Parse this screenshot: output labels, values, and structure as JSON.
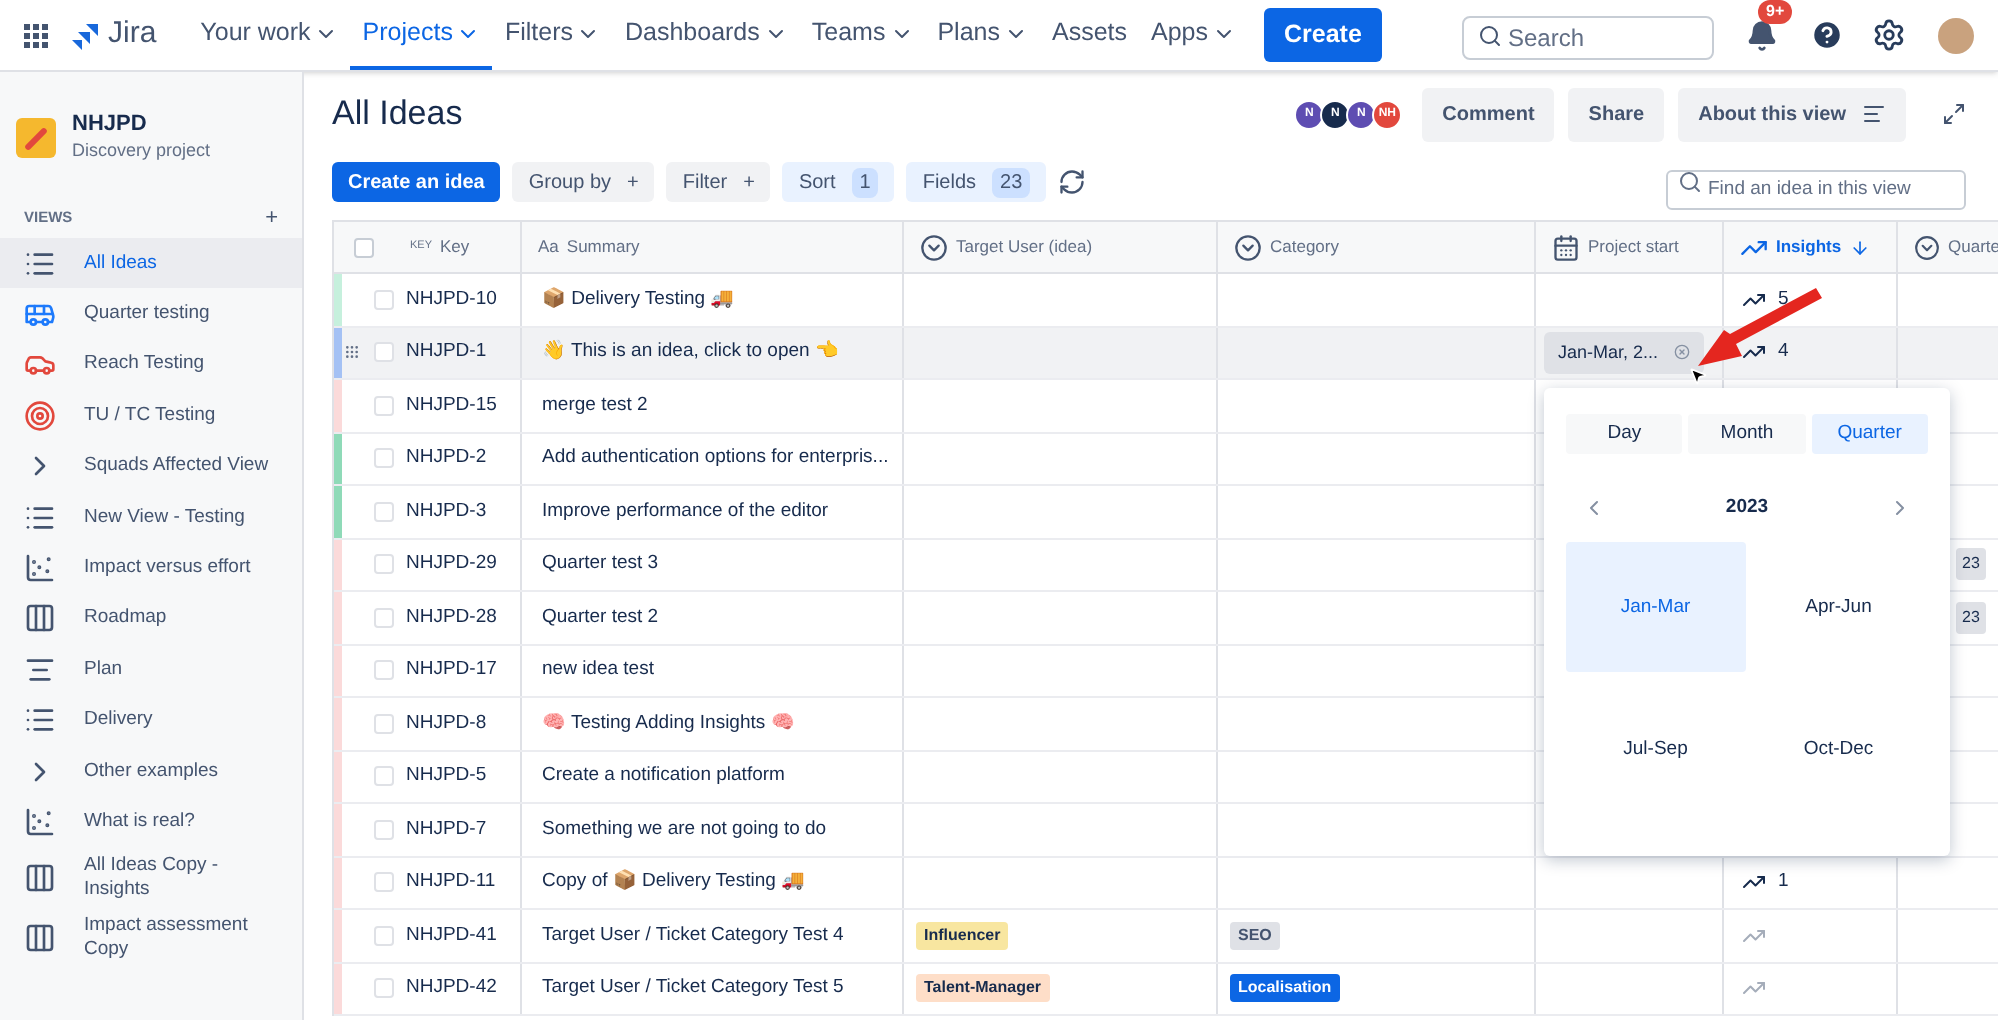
{
  "nav": {
    "items": [
      {
        "label": "Your work",
        "dropdown": true,
        "selected": false
      },
      {
        "label": "Projects",
        "dropdown": true,
        "selected": true
      },
      {
        "label": "Filters",
        "dropdown": true,
        "selected": false
      },
      {
        "label": "Dashboards",
        "dropdown": true,
        "selected": false
      },
      {
        "label": "Teams",
        "dropdown": true,
        "selected": false
      },
      {
        "label": "Plans",
        "dropdown": true,
        "selected": false
      },
      {
        "label": "Assets",
        "dropdown": false,
        "selected": false
      },
      {
        "label": "Apps",
        "dropdown": true,
        "selected": false
      }
    ],
    "logo": "Jira",
    "create": "Create",
    "search": {
      "placeholder": "Search"
    },
    "notifications": "9+"
  },
  "project": {
    "name": "NHJPD",
    "type": "Discovery project"
  },
  "sidebar": {
    "heading": "VIEWS",
    "add": "+",
    "items": [
      {
        "label": "All Ideas",
        "kind": "list",
        "selected": true
      },
      {
        "label": "Quarter testing",
        "kind": "bus",
        "selected": false
      },
      {
        "label": "Reach Testing",
        "kind": "car",
        "selected": false
      },
      {
        "label": "TU / TC Testing",
        "kind": "target",
        "selected": false
      },
      {
        "label": "Squads Affected View",
        "kind": "section",
        "selected": false
      },
      {
        "label": "New View - Testing",
        "kind": "list",
        "selected": false
      },
      {
        "label": "Impact versus effort",
        "kind": "matrix",
        "selected": false
      },
      {
        "label": "Roadmap",
        "kind": "board",
        "selected": false
      },
      {
        "label": "Plan",
        "kind": "timeline",
        "selected": false
      },
      {
        "label": "Delivery",
        "kind": "list",
        "selected": false
      },
      {
        "label": "Other examples",
        "kind": "section",
        "selected": false
      },
      {
        "label": "What is real?",
        "kind": "matrix",
        "selected": false
      },
      {
        "label": "All Ideas Copy - Insights",
        "kind": "board",
        "selected": false
      },
      {
        "label": "Impact assessment Copy",
        "kind": "board",
        "selected": false
      }
    ]
  },
  "header": {
    "title": "All Ideas",
    "avatars": [
      {
        "initials": "N",
        "color": "#5e4db2"
      },
      {
        "initials": "N",
        "color": "#172b4d"
      },
      {
        "initials": "N",
        "color": "#5e4db2"
      },
      {
        "initials": "NH",
        "color": "#e2483d"
      }
    ],
    "comment": "Comment",
    "share": "Share",
    "about": "About this view"
  },
  "toolbar": {
    "buttons": [
      {
        "label": "Create an idea",
        "kind": "primary"
      },
      {
        "label": "Group by",
        "kind": "add",
        "badge": "+"
      },
      {
        "label": "Filter",
        "kind": "add",
        "badge": "+"
      },
      {
        "label": "Sort",
        "kind": "count",
        "badge": "1"
      },
      {
        "label": "Fields",
        "kind": "count",
        "badge": "23"
      }
    ],
    "find": {
      "placeholder": "Find an idea in this view"
    }
  },
  "table": {
    "select_all": {
      "checked": false
    },
    "columns": [
      {
        "kind": "key",
        "prefix": "KEY",
        "label": "Key",
        "sorted": false
      },
      {
        "kind": "summary",
        "prefix": "Aa",
        "label": "Summary",
        "sorted": false
      },
      {
        "kind": "select",
        "label": "Target User (idea)",
        "sorted": false
      },
      {
        "kind": "select",
        "label": "Category",
        "sorted": false
      },
      {
        "kind": "date",
        "label": "Project start",
        "sorted": false
      },
      {
        "kind": "insights",
        "label": "Insights",
        "sorted": true
      },
      {
        "kind": "select",
        "label": "Quarte",
        "sorted": false
      }
    ],
    "rows": [
      {
        "key": "NHJPD-10",
        "summary": "📦 Delivery Testing 🚚",
        "color": "#c6f0dd",
        "checked": false,
        "hovered": false,
        "insights": {
          "count": "5",
          "faded": false
        }
      },
      {
        "key": "NHJPD-1",
        "summary": "👋 This is an idea, click to open 👈",
        "color": "#a4c1f4",
        "checked": false,
        "hovered": true,
        "project_start": "Jan-Mar, 2...",
        "insights": {
          "count": "4",
          "faded": false
        }
      },
      {
        "key": "NHJPD-15",
        "summary": "merge test 2",
        "color": "#fbdada",
        "checked": false,
        "hovered": false
      },
      {
        "key": "NHJPD-2",
        "summary": "Add authentication options for enterpris...",
        "color": "#8fdab8",
        "checked": false,
        "hovered": false
      },
      {
        "key": "NHJPD-3",
        "summary": "Improve performance of the editor",
        "color": "#8fdab8",
        "checked": false,
        "hovered": false
      },
      {
        "key": "NHJPD-29",
        "summary": "Quarter test 3",
        "color": "#fbdada",
        "checked": false,
        "hovered": false,
        "quarter": "23"
      },
      {
        "key": "NHJPD-28",
        "summary": "Quarter test 2",
        "color": "#fbdada",
        "checked": false,
        "hovered": false,
        "quarter": "23"
      },
      {
        "key": "NHJPD-17",
        "summary": "new idea test",
        "color": "#fbdada",
        "checked": false,
        "hovered": false
      },
      {
        "key": "NHJPD-8",
        "summary": "🧠 Testing Adding Insights 🧠",
        "color": "#fbdada",
        "checked": false,
        "hovered": false
      },
      {
        "key": "NHJPD-5",
        "summary": "Create a notification platform",
        "color": "#fbdada",
        "checked": false,
        "hovered": false
      },
      {
        "key": "NHJPD-7",
        "summary": "Something we are not going to do",
        "color": "#fbdada",
        "checked": false,
        "hovered": false
      },
      {
        "key": "NHJPD-11",
        "summary": "Copy of 📦 Delivery Testing 🚚",
        "color": "#fbdada",
        "checked": false,
        "hovered": false,
        "insights": {
          "count": "1",
          "faded": false
        }
      },
      {
        "key": "NHJPD-41",
        "summary": "Target User / Ticket Category Test 4",
        "color": "#fbdada",
        "checked": false,
        "hovered": false,
        "target_user": {
          "label": "Influencer",
          "color": "#f8e6a0"
        },
        "category": {
          "label": "SEO",
          "color": "#dfe1e6"
        },
        "insights": {
          "faded": true
        }
      },
      {
        "key": "NHJPD-42",
        "summary": "Target User / Ticket Category Test 5",
        "color": "#fbdada",
        "checked": false,
        "hovered": false,
        "target_user": {
          "label": "Talent-Manager",
          "color": "#fedec8"
        },
        "category": {
          "label": "Localisation",
          "color": "#0c66e4"
        },
        "insights": {
          "faded": true
        }
      }
    ]
  },
  "picker": {
    "modes": [
      {
        "label": "Day",
        "selected": false
      },
      {
        "label": "Month",
        "selected": false
      },
      {
        "label": "Quarter",
        "selected": true
      }
    ],
    "year": "2023",
    "quarters": [
      {
        "label": "Jan-Mar",
        "selected": true
      },
      {
        "label": "Apr-Jun",
        "selected": false
      },
      {
        "label": "Jul-Sep",
        "selected": false
      },
      {
        "label": "Oct-Dec",
        "selected": false
      }
    ]
  }
}
